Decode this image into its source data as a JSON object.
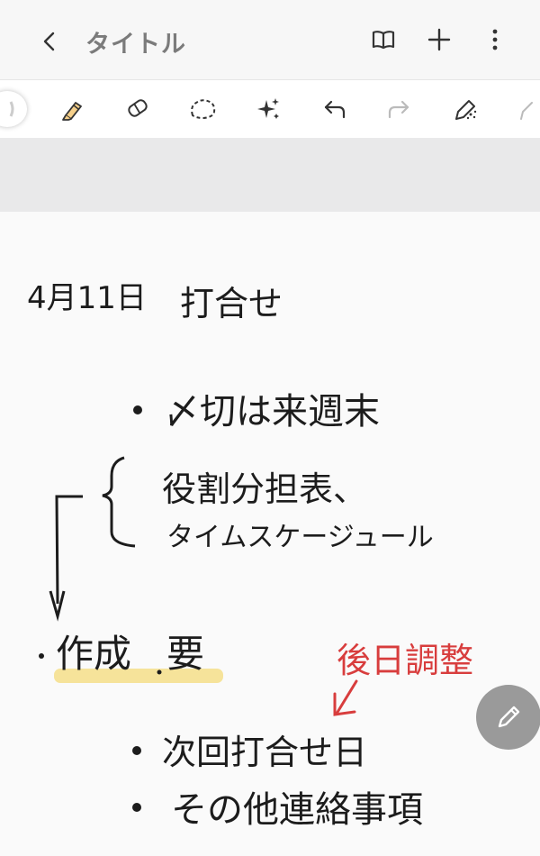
{
  "header": {
    "title": "タイトル"
  },
  "toolbar": {
    "tools": [
      "pen-icon",
      "highlighter-icon",
      "eraser-icon",
      "lasso-icon",
      "ai-sparkle-icon",
      "undo-icon",
      "redo-icon",
      "pen-settings-icon",
      "pencil-icon"
    ]
  },
  "note": {
    "line1": "4月11日",
    "line1b": "打合せ",
    "bullet1": "〆切は来週末",
    "brace1": "役割分担表、",
    "brace2": "タイムスケージュール",
    "action_a": "作成",
    "action_b": "要",
    "red_note": "後日調整",
    "bullet3": "次回打合せ日",
    "bullet4": "その他連絡事項"
  },
  "colors": {
    "ink": "#1c1c1c",
    "red_ink": "#d83d3d",
    "highlight": "#f6e39a"
  }
}
